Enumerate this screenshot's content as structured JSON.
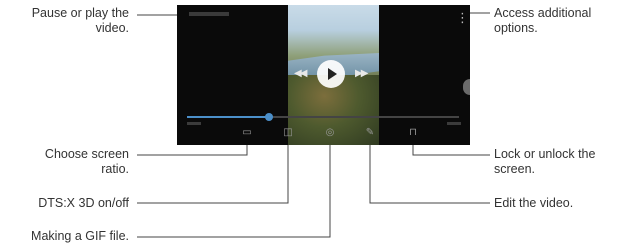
{
  "callouts": {
    "pause_play": "Pause or play the\nvideo.",
    "screen_ratio": "Choose screen\nratio.",
    "dtsx": "DTS:X 3D on/off",
    "gif": "Making a GIF file.",
    "more_options": "Access additional\noptions.",
    "lock": "Lock or unlock the\nscreen.",
    "edit": "Edit the video."
  },
  "player": {
    "progress": 0.3,
    "icons": {
      "more": "more-vertical-icon",
      "play": "play-icon",
      "prev": "rewind-icon",
      "next": "fast-forward-icon",
      "ratio": "screen-ratio-icon",
      "dtsx": "dtsx-3d-icon",
      "gif": "gif-icon",
      "edit": "edit-pencil-icon",
      "lock": "lock-icon"
    }
  },
  "colors": {
    "accent": "#4b8fc9",
    "lines": "#444444"
  }
}
